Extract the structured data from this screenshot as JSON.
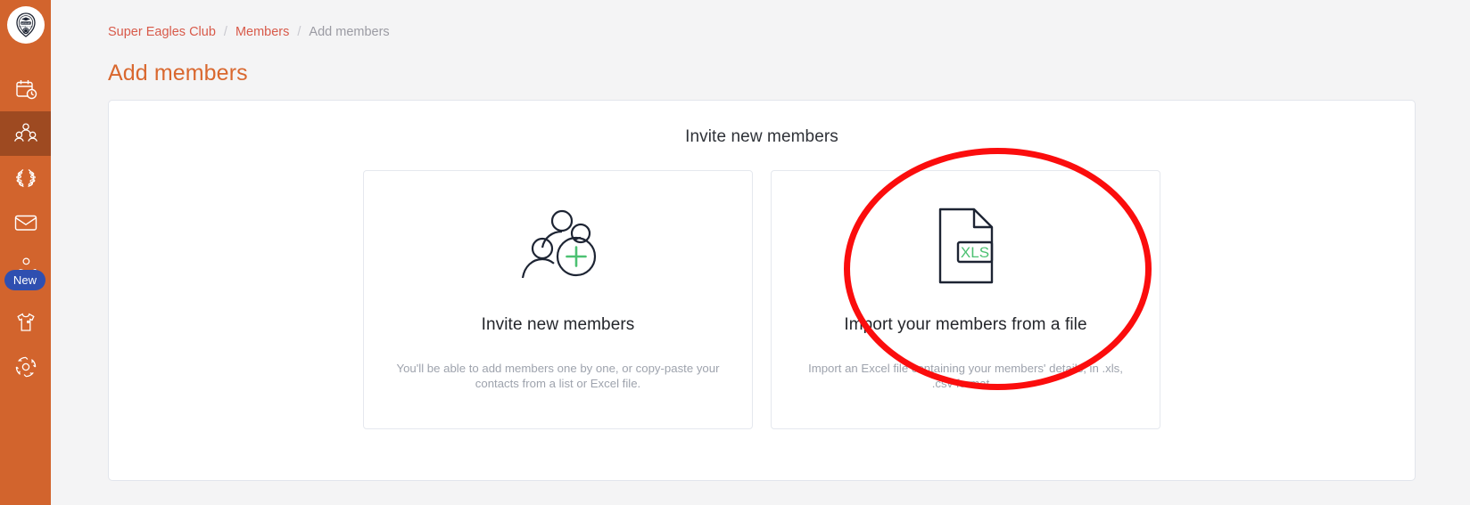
{
  "sidebar": {
    "logo": {
      "name": "club-logo",
      "alt": "EAGLES"
    },
    "items": [
      {
        "icon": "calendar-clock-icon",
        "name": "sidebar-item-events",
        "active": false
      },
      {
        "icon": "members-icon",
        "name": "sidebar-item-members",
        "active": true
      },
      {
        "icon": "laurel-wreath-icon",
        "name": "sidebar-item-competitions",
        "active": false
      },
      {
        "icon": "mail-icon",
        "name": "sidebar-item-messages",
        "active": false
      },
      {
        "icon": "donation-hand-icon",
        "name": "sidebar-item-donations",
        "active": false
      },
      {
        "icon": "tshirt-icon",
        "name": "sidebar-item-shop",
        "active": false
      },
      {
        "icon": "gear-icon",
        "name": "sidebar-item-settings",
        "active": false
      }
    ],
    "new_badge_label": "New"
  },
  "breadcrumb": {
    "club": "Super Eagles Club",
    "section": "Members",
    "current": "Add members",
    "separator": "/"
  },
  "page": {
    "title": "Add members"
  },
  "panel": {
    "heading": "Invite new members",
    "cards": [
      {
        "name": "invite-new-members-card",
        "icon": "people-add-icon",
        "title": "Invite new members",
        "description": "You'll be able to add members one by one, or copy-paste your contacts from a list or Excel file."
      },
      {
        "name": "import-members-from-file-card",
        "icon": "xls-file-icon",
        "icon_label": "XLS",
        "title": "Import your members from a file",
        "description": "Import an Excel file containing your members' details, in .xls, .csv format..."
      }
    ]
  },
  "annotation": {
    "shape": "ellipse",
    "color": "#fb0d0d",
    "target": "import-members-from-file-card"
  },
  "colors": {
    "sidebar_bg": "#d2642d",
    "sidebar_active": "#9e4a21",
    "page_bg": "#f4f4f5",
    "title_orange": "#d9682f",
    "breadcrumb_link": "#d85a4a",
    "badge_blue": "#2f4fb0",
    "icon_green": "#4cc172",
    "icon_dark": "#1d2433"
  }
}
